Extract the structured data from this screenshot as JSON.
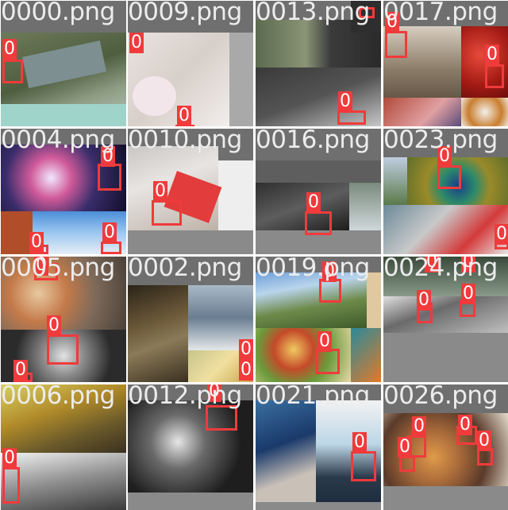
{
  "tiles": [
    {
      "title": "0000.png",
      "labels": [
        "0"
      ]
    },
    {
      "title": "0009.png",
      "labels": [
        "0",
        "0"
      ]
    },
    {
      "title": "0013.png",
      "labels": [
        "0"
      ]
    },
    {
      "title": "0017.png",
      "labels": [
        "0",
        "0"
      ]
    },
    {
      "title": "0004.png",
      "labels": [
        "0",
        "0",
        "0"
      ]
    },
    {
      "title": "0010.png",
      "labels": [
        "0"
      ]
    },
    {
      "title": "0016.png",
      "labels": [
        "0"
      ]
    },
    {
      "title": "0023.png",
      "labels": [
        "0",
        "0"
      ]
    },
    {
      "title": "0005.png",
      "labels": [
        "0",
        "0",
        "0",
        "0"
      ]
    },
    {
      "title": "0002.png",
      "labels": [
        "0",
        "0"
      ]
    },
    {
      "title": "0019.png",
      "labels": [
        "0",
        "0"
      ]
    },
    {
      "title": "0024.png",
      "labels": [
        "0",
        "0",
        "0",
        "0"
      ]
    },
    {
      "title": "0006.png",
      "labels": [
        "0"
      ]
    },
    {
      "title": "0012.png",
      "labels": [
        "0"
      ]
    },
    {
      "title": "0021.png",
      "labels": [
        "0"
      ]
    },
    {
      "title": "0026.png",
      "labels": [
        "0",
        "0",
        "0",
        "0"
      ]
    }
  ],
  "colors": {
    "box": "#ef3b3b",
    "title": "#ececec",
    "tile_bg": "#6f6f6f"
  }
}
